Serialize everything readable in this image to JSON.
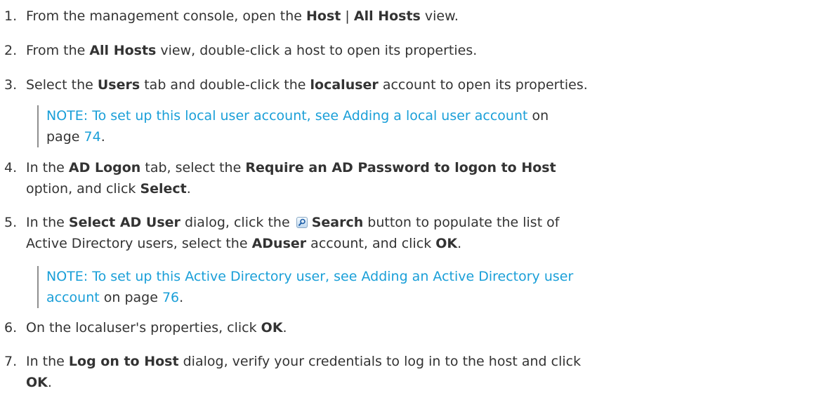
{
  "steps": [
    {
      "num": "1.",
      "parts": [
        "From the management console, open the ",
        "Host",
        " | ",
        "All Hosts",
        " view."
      ]
    },
    {
      "num": "2.",
      "parts": [
        "From the ",
        "All Hosts",
        " view, double-click a host to open its properties."
      ]
    },
    {
      "num": "3.",
      "parts": [
        "Select the ",
        "Users",
        " tab and double-click the ",
        "localuser",
        " account to open its properties."
      ]
    },
    {
      "num": "4.",
      "parts": [
        "In the ",
        "AD Logon",
        " tab, select the ",
        "Require an AD Password to logon to Host",
        "option, and click ",
        "Select",
        "."
      ]
    },
    {
      "num": "5.",
      "parts": [
        "In the ",
        "Select AD User",
        " dialog, click the ",
        "Search",
        " button to populate the list of",
        "Active Directory users, select the ",
        "ADuser",
        " account, and click ",
        "OK",
        "."
      ]
    },
    {
      "num": "6.",
      "parts": [
        "On the localuser's properties, click ",
        "OK",
        "."
      ]
    },
    {
      "num": "7.",
      "parts": [
        "In the ",
        "Log on to Host",
        " dialog, verify your credentials to log in to the host and click",
        "OK",
        "."
      ]
    }
  ],
  "notes": [
    {
      "label": "NOTE:",
      "text_before": " To set up this local user account, see ",
      "link": "Adding a local user account",
      "text_on": " on",
      "text_page": "page ",
      "page": "74",
      "text_after": "."
    },
    {
      "label": "NOTE:",
      "text_before": " To set up this Active Directory user, see ",
      "link_line1": "Adding an Active Directory user",
      "link_line2": "account",
      "text_on": " on page ",
      "page": "76",
      "text_after": "."
    }
  ],
  "colors": {
    "link": "#1a9fd8",
    "text": "#333333",
    "note_bar": "#8f8f8f"
  },
  "icons": [
    "search-icon"
  ]
}
